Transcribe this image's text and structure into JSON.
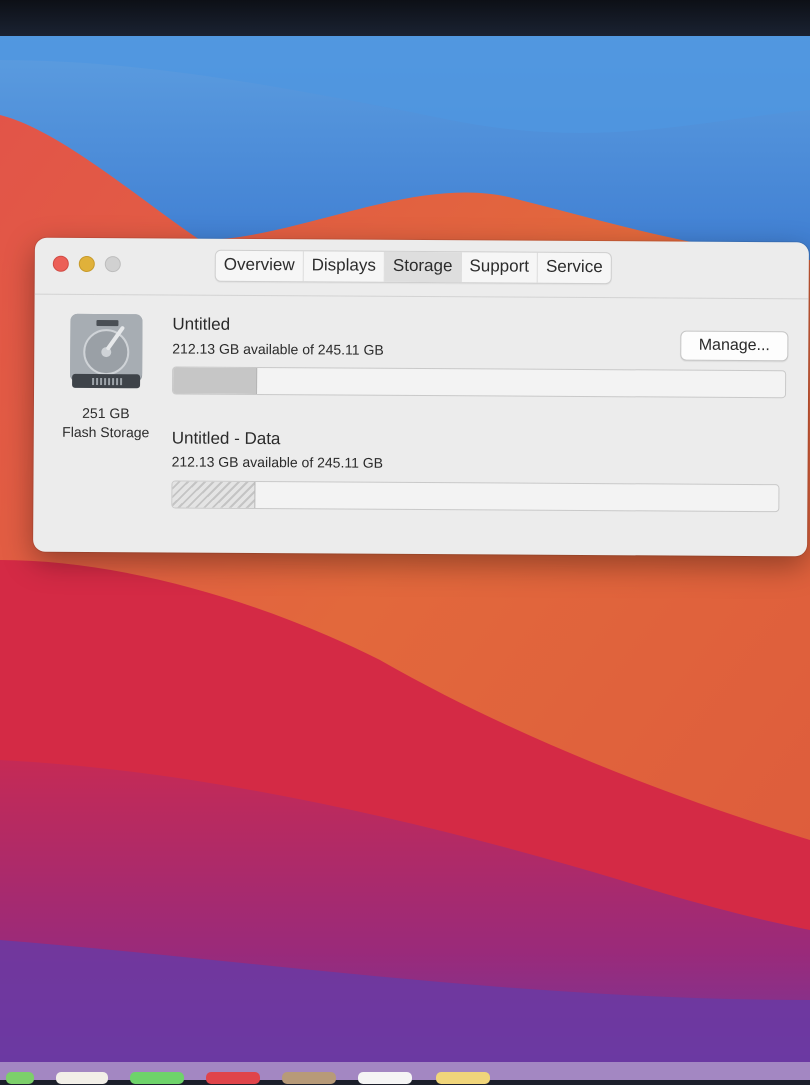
{
  "window": {
    "tabs": [
      {
        "label": "Overview"
      },
      {
        "label": "Displays"
      },
      {
        "label": "Storage"
      },
      {
        "label": "Support"
      },
      {
        "label": "Service"
      }
    ],
    "active_tab": "Storage"
  },
  "storage": {
    "drive_icon": "hard-drive-icon",
    "capacity": "251 GB",
    "type": "Flash Storage",
    "manage_label": "Manage...",
    "volumes": [
      {
        "name": "Untitled",
        "info": "212.13 GB available of 245.11 GB",
        "used_fraction": 0.135
      },
      {
        "name": "Untitled - Data",
        "info": "212.13 GB available of 245.11 GB",
        "used_fraction": 0.135
      }
    ]
  },
  "colors": {
    "close": "#ec5f57",
    "minimize": "#e0b13a",
    "zoom_disabled": "#d1d1d1"
  }
}
